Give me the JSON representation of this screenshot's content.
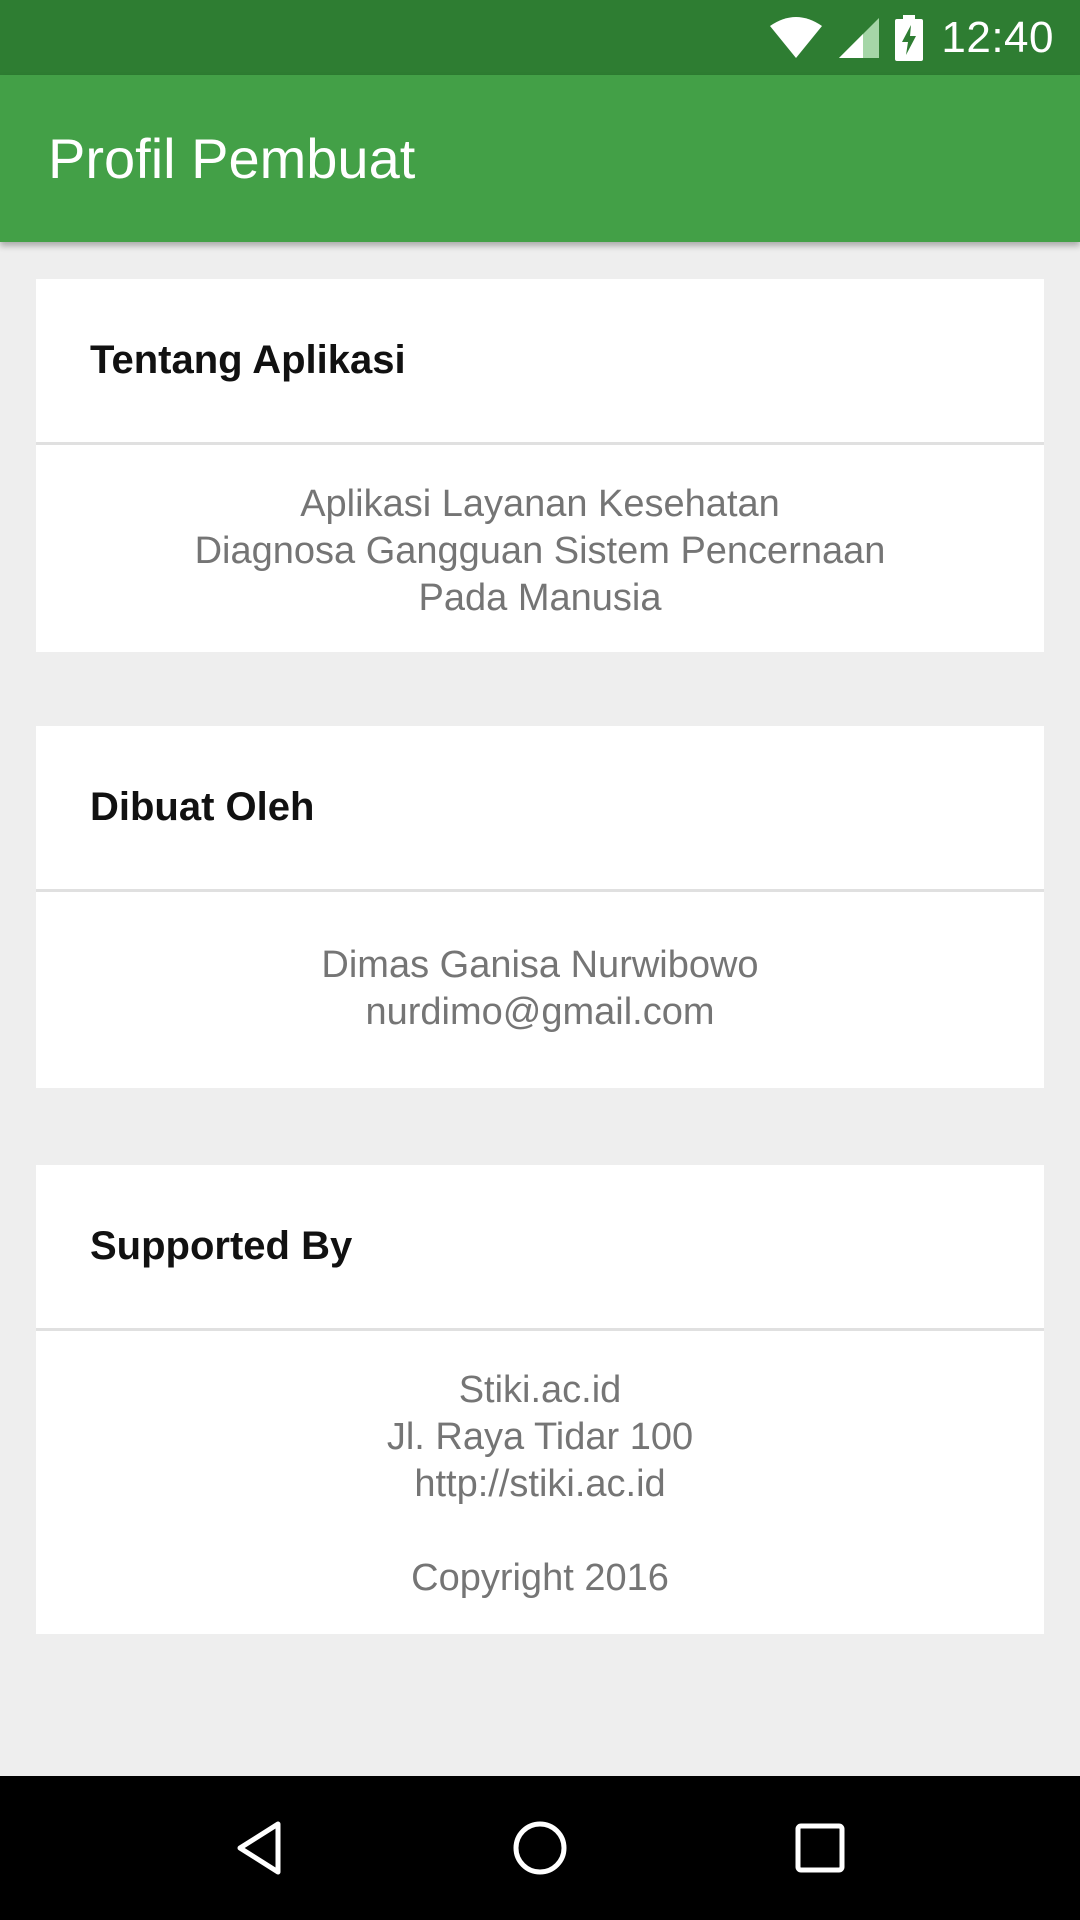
{
  "status_bar": {
    "time": "12:40",
    "icons": [
      "wifi-icon",
      "signal-icon",
      "battery-charging-icon"
    ]
  },
  "app_bar": {
    "title": "Profil Pembuat",
    "color": "#43a047"
  },
  "cards": [
    {
      "heading": "Tentang Aplikasi",
      "lines": [
        "Aplikasi Layanan Kesehatan",
        "Diagnosa Gangguan Sistem Pencernaan",
        "Pada Manusia"
      ]
    },
    {
      "heading": "Dibuat Oleh",
      "lines": [
        "Dimas Ganisa Nurwibowo",
        "nurdimo@gmail.com"
      ]
    },
    {
      "heading": "Supported By",
      "lines": [
        "Stiki.ac.id",
        "Jl. Raya Tidar 100",
        "http://stiki.ac.id",
        "",
        "Copyright 2016"
      ]
    }
  ],
  "nav_bar": {
    "buttons": [
      "back-icon",
      "home-icon",
      "recents-icon"
    ]
  },
  "colors": {
    "status_bar": "#2e7d32",
    "app_bar": "#43a047",
    "background": "#eeeeee",
    "body_text": "#757575"
  }
}
